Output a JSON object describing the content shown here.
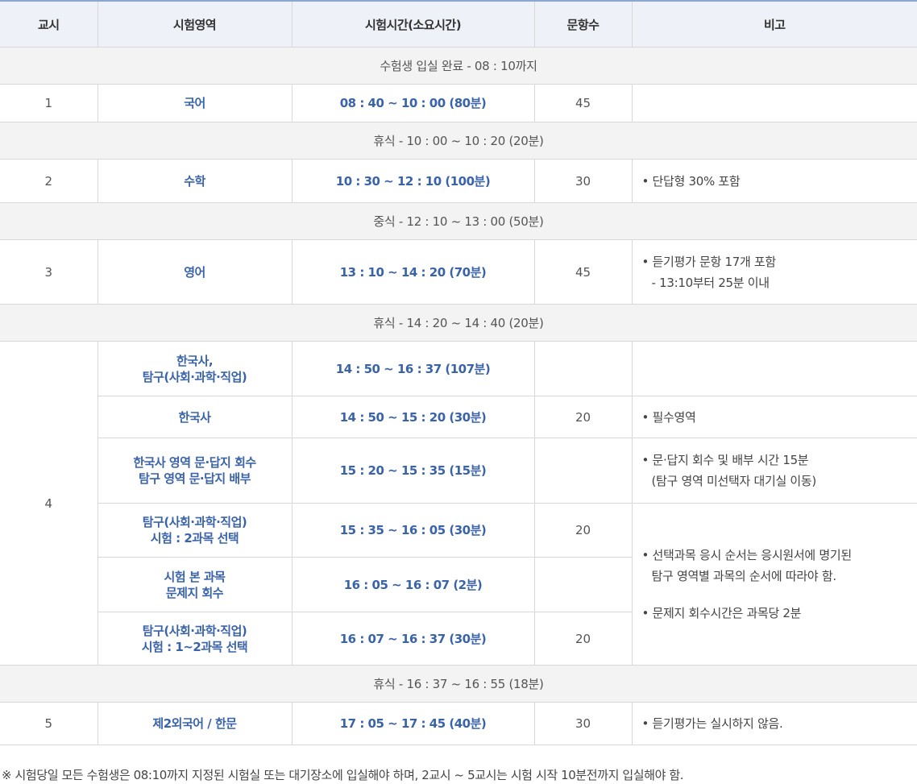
{
  "headers": {
    "period": "교시",
    "area": "시험영역",
    "time": "시험시간(소요시간)",
    "count": "문항수",
    "note": "비고"
  },
  "gaps": {
    "entry": "수험생 입실 완료 - 08 : 10까지",
    "break1": "휴식 - 10 : 00 ~ 10 : 20 (20분)",
    "lunch": "중식 - 12 : 10 ~ 13 : 00 (50분)",
    "break2": "휴식 - 14 : 20 ~ 14 : 40 (20분)",
    "break3": "휴식 - 16 : 37 ~ 16 : 55 (18분)"
  },
  "p1": {
    "period": "1",
    "subject": "국어",
    "time": "08 : 40 ~ 10 : 00 (80분)",
    "count": "45",
    "note": ""
  },
  "p2": {
    "period": "2",
    "subject": "수학",
    "time": "10 : 30 ~ 12 : 10 (100분)",
    "count": "30",
    "note": "• 단답형 30% 포함"
  },
  "p3": {
    "period": "3",
    "subject": "영어",
    "time": "13 : 10 ~ 14 : 20 (70분)",
    "count": "45",
    "note1": "• 듣기평가 문항 17개 포함",
    "note2": "- 13:10부터 25분 이내"
  },
  "p4": {
    "period": "4",
    "r1": {
      "subject1": "한국사,",
      "subject2": "탐구(사회·과학·직업)",
      "time": "14 : 50 ~ 16 : 37 (107분)"
    },
    "r2": {
      "subject": "한국사",
      "time": "14 : 50 ~ 15 : 20 (30분)",
      "count": "20",
      "note": "• 필수영역"
    },
    "r3": {
      "subject1": "한국사 영역 문·답지 회수",
      "subject2": "탐구 영역 문·답지 배부",
      "time": "15 : 20 ~ 15 : 35 (15분)",
      "note1": "• 문·답지 회수 및 배부 시간 15분",
      "note2": "(탐구 영역 미선택자 대기실 이동)"
    },
    "r4": {
      "subject1": "탐구(사회·과학·직업)",
      "subject2": "시험 : 2과목 선택",
      "time": "15 : 35 ~ 16 : 05 (30분)",
      "count": "20",
      "note1": "• 선택과목 응시 순서는 응시원서에 명기된",
      "note2": "탐구 영역별 과목의 순서에 따라야 함.",
      "note3": "• 문제지 회수시간은 과목당 2분"
    },
    "r5": {
      "subject1": "시험 본 과목",
      "subject2": "문제지 회수",
      "time": "16 : 05 ~ 16 : 07 (2분)"
    },
    "r6": {
      "subject1": "탐구(사회·과학·직업)",
      "subject2": "시험 : 1~2과목 선택",
      "time": "16 : 07 ~ 16 : 37 (30분)",
      "count": "20"
    }
  },
  "p5": {
    "period": "5",
    "subject": "제2외국어 / 한문",
    "time": "17 : 05 ~ 17 : 45 (40분)",
    "count": "30",
    "note": "• 듣기평가는 실시하지 않음."
  },
  "footnote": "※ 시험당일 모든 수험생은 08:10까지 지정된 시험실 또는 대기장소에 입실해야 하며, 2교시 ~ 5교시는 시험 시작 10분전까지 입실해야 함."
}
